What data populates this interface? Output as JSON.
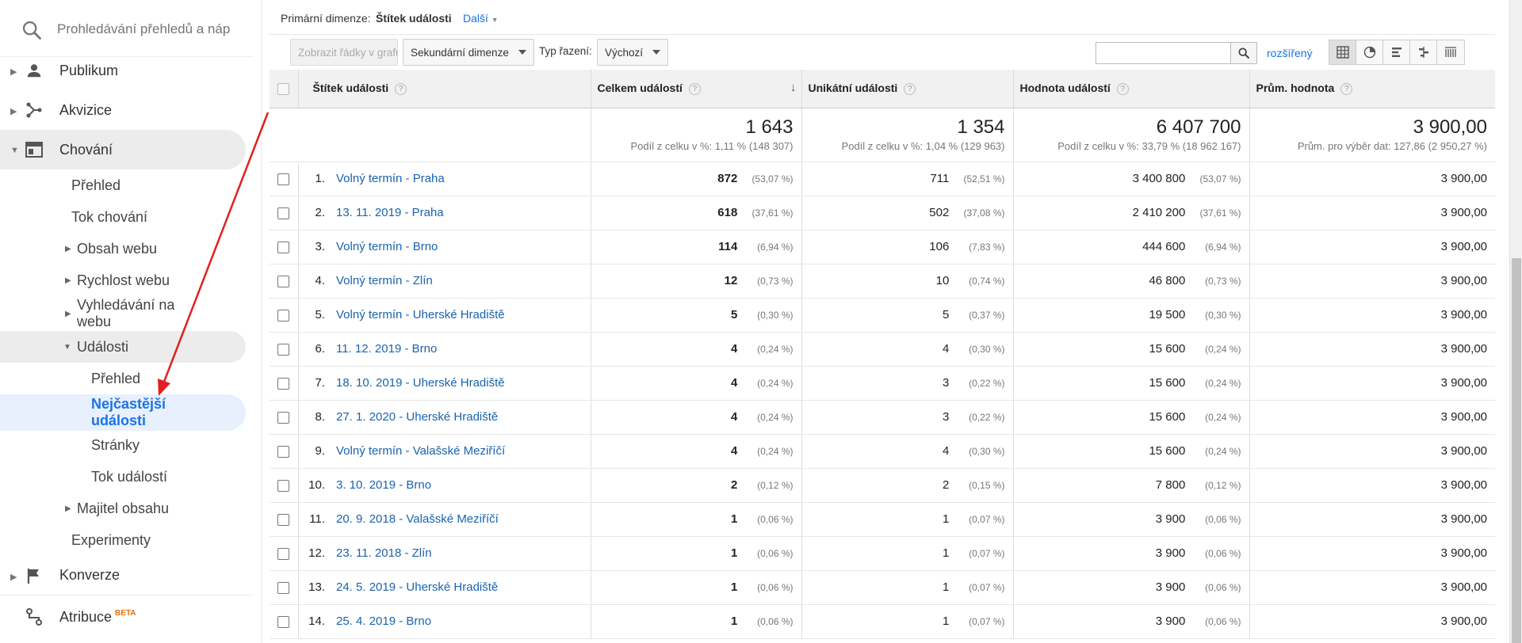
{
  "sidebar": {
    "search_placeholder": "Prohledávání přehledů a náp",
    "sections": [
      {
        "label": "Publikum"
      },
      {
        "label": "Akvizice"
      },
      {
        "label": "Chování"
      }
    ],
    "behavior_items": [
      {
        "label": "Přehled"
      },
      {
        "label": "Tok chování"
      },
      {
        "label": "Obsah webu"
      },
      {
        "label": "Rychlost webu"
      },
      {
        "label": "Vyhledávání na webu"
      },
      {
        "label": "Události"
      }
    ],
    "events_items": [
      {
        "label": "Přehled"
      },
      {
        "label": "Nejčastější události"
      },
      {
        "label": "Stránky"
      },
      {
        "label": "Tok událostí"
      }
    ],
    "after_items": [
      {
        "label": "Majitel obsahu"
      },
      {
        "label": "Experimenty"
      }
    ],
    "conversions": "Konverze",
    "attribution": "Atribuce",
    "beta": "BETA"
  },
  "dimbar": {
    "primary_label": "Primární dimenze:",
    "primary_value": "Štítek události",
    "more": "Další"
  },
  "toolbar": {
    "plot_rows": "Zobrazit řádky v grafu",
    "secondary_dim": "Sekundární dimenze",
    "sort_label": "Typ řazení:",
    "sort_value": "Výchozí",
    "advanced": "rozšířený"
  },
  "table": {
    "headers": {
      "label": "Štítek události",
      "total": "Celkem událostí",
      "unique": "Unikátní události",
      "value": "Hodnota událostí",
      "avg": "Prům. hodnota"
    },
    "totals": {
      "total": "1 643",
      "total_sub": "Podíl z celku v %: 1,11 % (148 307)",
      "unique": "1 354",
      "unique_sub": "Podíl z celku v %: 1,04 % (129 963)",
      "value": "6 407 700",
      "value_sub": "Podíl z celku v %: 33,79 % (18 962 167)",
      "avg": "3 900,00",
      "avg_sub": "Prům. pro výběr dat: 127,86 (2 950,27 %)"
    },
    "rows": [
      {
        "idx": "1.",
        "label": "Volný termín - Praha",
        "total": "872",
        "total_pct": "(53,07 %)",
        "unique": "711",
        "unique_pct": "(52,51 %)",
        "value": "3 400 800",
        "value_pct": "(53,07 %)",
        "avg": "3 900,00"
      },
      {
        "idx": "2.",
        "label": "13. 11. 2019 - Praha",
        "total": "618",
        "total_pct": "(37,61 %)",
        "unique": "502",
        "unique_pct": "(37,08 %)",
        "value": "2 410 200",
        "value_pct": "(37,61 %)",
        "avg": "3 900,00"
      },
      {
        "idx": "3.",
        "label": "Volný termín - Brno",
        "total": "114",
        "total_pct": "(6,94 %)",
        "unique": "106",
        "unique_pct": "(7,83 %)",
        "value": "444 600",
        "value_pct": "(6,94 %)",
        "avg": "3 900,00"
      },
      {
        "idx": "4.",
        "label": "Volný termín - Zlín",
        "total": "12",
        "total_pct": "(0,73 %)",
        "unique": "10",
        "unique_pct": "(0,74 %)",
        "value": "46 800",
        "value_pct": "(0,73 %)",
        "avg": "3 900,00"
      },
      {
        "idx": "5.",
        "label": "Volný termín - Uherské Hradiště",
        "total": "5",
        "total_pct": "(0,30 %)",
        "unique": "5",
        "unique_pct": "(0,37 %)",
        "value": "19 500",
        "value_pct": "(0,30 %)",
        "avg": "3 900,00"
      },
      {
        "idx": "6.",
        "label": "11. 12. 2019 - Brno",
        "total": "4",
        "total_pct": "(0,24 %)",
        "unique": "4",
        "unique_pct": "(0,30 %)",
        "value": "15 600",
        "value_pct": "(0,24 %)",
        "avg": "3 900,00"
      },
      {
        "idx": "7.",
        "label": "18. 10. 2019 - Uherské Hradiště",
        "total": "4",
        "total_pct": "(0,24 %)",
        "unique": "3",
        "unique_pct": "(0,22 %)",
        "value": "15 600",
        "value_pct": "(0,24 %)",
        "avg": "3 900,00"
      },
      {
        "idx": "8.",
        "label": "27. 1. 2020 - Uherské Hradiště",
        "total": "4",
        "total_pct": "(0,24 %)",
        "unique": "3",
        "unique_pct": "(0,22 %)",
        "value": "15 600",
        "value_pct": "(0,24 %)",
        "avg": "3 900,00"
      },
      {
        "idx": "9.",
        "label": "Volný termín - Valašské Meziříčí",
        "total": "4",
        "total_pct": "(0,24 %)",
        "unique": "4",
        "unique_pct": "(0,30 %)",
        "value": "15 600",
        "value_pct": "(0,24 %)",
        "avg": "3 900,00"
      },
      {
        "idx": "10.",
        "label": "3. 10. 2019 - Brno",
        "total": "2",
        "total_pct": "(0,12 %)",
        "unique": "2",
        "unique_pct": "(0,15 %)",
        "value": "7 800",
        "value_pct": "(0,12 %)",
        "avg": "3 900,00"
      },
      {
        "idx": "11.",
        "label": "20. 9. 2018 - Valašské Meziříčí",
        "total": "1",
        "total_pct": "(0,06 %)",
        "unique": "1",
        "unique_pct": "(0,07 %)",
        "value": "3 900",
        "value_pct": "(0,06 %)",
        "avg": "3 900,00"
      },
      {
        "idx": "12.",
        "label": "23. 11. 2018 - Zlín",
        "total": "1",
        "total_pct": "(0,06 %)",
        "unique": "1",
        "unique_pct": "(0,07 %)",
        "value": "3 900",
        "value_pct": "(0,06 %)",
        "avg": "3 900,00"
      },
      {
        "idx": "13.",
        "label": "24. 5. 2019 - Uherské Hradiště",
        "total": "1",
        "total_pct": "(0,06 %)",
        "unique": "1",
        "unique_pct": "(0,07 %)",
        "value": "3 900",
        "value_pct": "(0,06 %)",
        "avg": "3 900,00"
      },
      {
        "idx": "14.",
        "label": "25. 4. 2019 - Brno",
        "total": "1",
        "total_pct": "(0,06 %)",
        "unique": "1",
        "unique_pct": "(0,07 %)",
        "value": "3 900",
        "value_pct": "(0,06 %)",
        "avg": "3 900,00"
      }
    ]
  },
  "colors": {
    "accent": "#1a73e8",
    "link": "#1a63b0",
    "arrow": "#e02020"
  }
}
